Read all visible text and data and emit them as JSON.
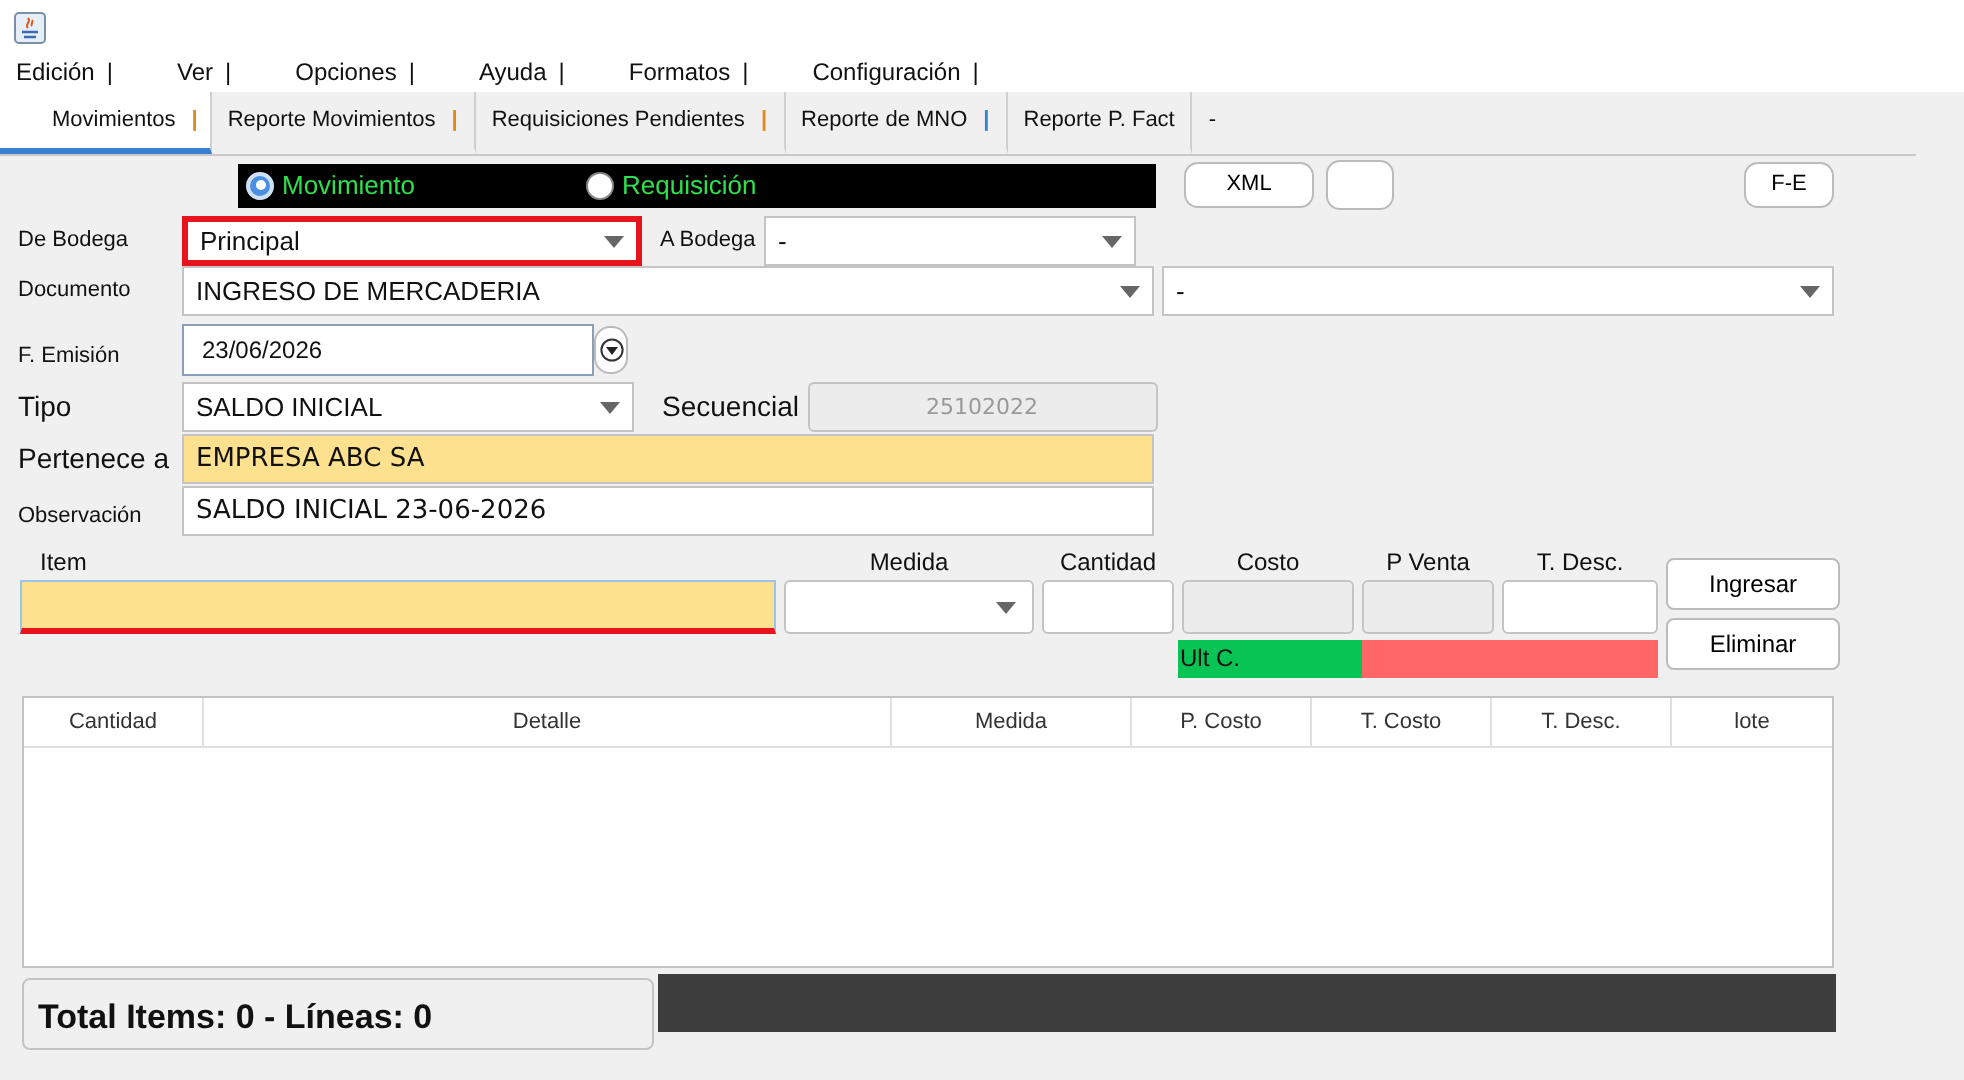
{
  "menu": [
    {
      "label": "Edición",
      "separator": "|"
    },
    {
      "label": "Ver",
      "separator": "|"
    },
    {
      "label": "Opciones",
      "separator": "|"
    },
    {
      "label": "Ayuda",
      "separator": "|"
    },
    {
      "label": "Formatos",
      "separator": "|"
    },
    {
      "label": "Configuración",
      "separator": "|"
    }
  ],
  "tabs": [
    {
      "label": "Movimientos",
      "selected": true,
      "marker": "|",
      "color": "#e08a1e"
    },
    {
      "label": "Reporte Movimientos",
      "selected": false,
      "marker": "|",
      "color": "#e08a1e"
    },
    {
      "label": "Requisiciones Pendientes",
      "selected": false,
      "marker": "|",
      "color": "#e08a1e"
    },
    {
      "label": "Reporte de MNO",
      "selected": false,
      "marker": "|",
      "color": "#3a7fd0"
    },
    {
      "label": "Reporte P. Fact",
      "selected": false
    },
    {
      "label": "-",
      "selected": false
    }
  ],
  "mode_options": [
    {
      "label": "Movimiento",
      "selected": true
    },
    {
      "label": "Requisición",
      "selected": false
    }
  ],
  "toolbar_buttons": [
    "XML"
  ],
  "fe_button": "F-E",
  "de_bodega": {
    "label": "De Bodega",
    "value": "Principal",
    "invalid": true
  },
  "a_bodega": {
    "label": "A Bodega",
    "value": "-"
  },
  "documento": {
    "label": "Documento",
    "value": "INGRESO DE MERCADERIA",
    "value_2": "-"
  },
  "f_emision": {
    "label": "F. Emisión",
    "value": "23/06/2026"
  },
  "tipo": {
    "label": "Tipo",
    "value": "SALDO INICIAL"
  },
  "secuencial": {
    "label": "Secuencial",
    "value": "25102022",
    "disabled": true
  },
  "pertenece_a": {
    "label": "Pertenece a",
    "value": "EMPRESA ABC SA",
    "highlighted": true
  },
  "observacion": {
    "label": "Observación",
    "value": "SALDO INICIAL 23-06-2026",
    "highlighted": false
  },
  "entry": {
    "columns": [
      {
        "label": "Item",
        "kind": "text",
        "highlighted": true,
        "invalid": true
      },
      {
        "label": "Medida",
        "kind": "combo"
      },
      {
        "label": "Cantidad",
        "kind": "text"
      },
      {
        "label": "Costo",
        "kind": "text",
        "disabled": true
      },
      {
        "label": "P Venta",
        "kind": "text",
        "disabled": true
      },
      {
        "label": "T. Desc.",
        "kind": "text"
      }
    ],
    "buttons": [
      "Ingresar",
      "Eliminar"
    ],
    "last_cost_label": "Ult C."
  },
  "table": {
    "columns": [
      "Cantidad",
      "Detalle",
      "Medida",
      "P. Costo",
      "T. Costo",
      "T. Desc.",
      "lote"
    ]
  },
  "totals": "Total Items: 0 - Líneas: 0"
}
